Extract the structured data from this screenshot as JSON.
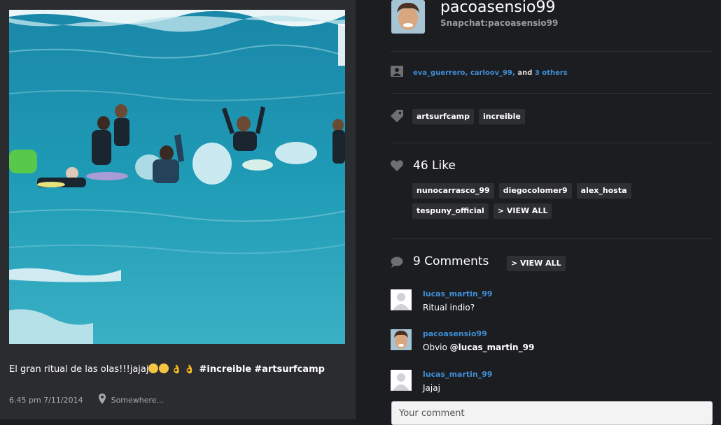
{
  "post": {
    "caption_text": "El gran ritual de las olas!!!jajaj",
    "caption_tags": [
      "#increible",
      "#artsurfcamp"
    ],
    "time": "6.45 pm 7/11/2014",
    "location": "Somewhere..."
  },
  "profile": {
    "username": "pacoasensio99",
    "snapchat": "Snapchat:pacoasensio99"
  },
  "tagged_users": {
    "user1": "eva_guerrero,",
    "user2": "carloov_99,",
    "and": "and",
    "others": "3 others"
  },
  "tags": [
    "artsurfcamp",
    "increible"
  ],
  "likes": {
    "count_label": "46 Like",
    "users": [
      "nunocarrasco_99",
      "diegocolomer9",
      "alex_hosta",
      "tespuny_official"
    ],
    "view_all": "> VIEW ALL"
  },
  "comments": {
    "count_label": "9 Comments",
    "view_all": "> VIEW ALL",
    "items": [
      {
        "user": "lucas_martin_99",
        "text": "Ritual indio?"
      },
      {
        "user": "pacoasensio99",
        "text_prefix": "Obvio",
        "mention": "@lucas_martin_99"
      },
      {
        "user": "lucas_martin_99",
        "text": "Jajaj"
      }
    ],
    "input_placeholder": "Your comment"
  },
  "icons": {
    "tagged": "person-icon",
    "tags": "tag-icon",
    "likes": "heart-icon",
    "comments": "speech-bubble-icon",
    "location": "map-pin-icon"
  },
  "colors": {
    "link": "#3f8fd8",
    "background": "#1c1d20",
    "left_panel": "#2b2c30"
  }
}
